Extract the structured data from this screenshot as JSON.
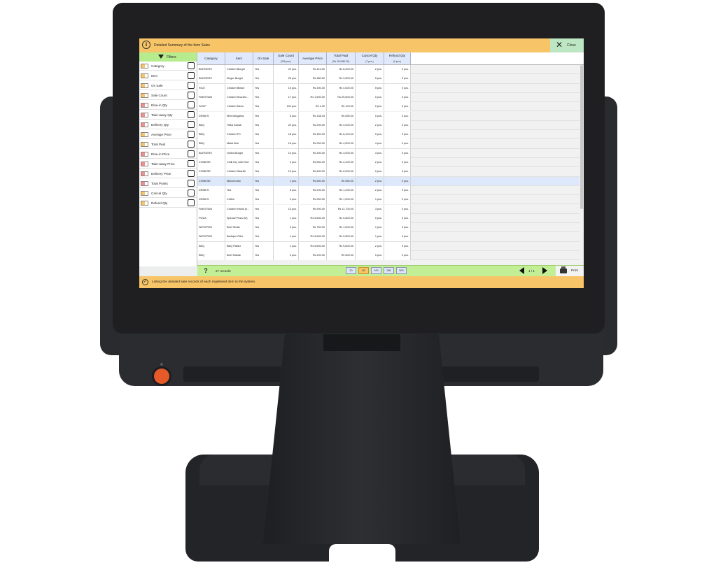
{
  "window": {
    "title": "Detailed Summary of the Item Sales",
    "close_label": "Close"
  },
  "filters": {
    "label": "Filters",
    "items": [
      {
        "label": "Category",
        "swatch": "#f7c567"
      },
      {
        "label": "Item",
        "swatch": "#f7c567"
      },
      {
        "label": "On Sale",
        "swatch": "#f7c567"
      },
      {
        "label": "Sale Count",
        "swatch": "#f7c567"
      },
      {
        "label": "Dine-in Qty",
        "swatch": "#ef8f8f"
      },
      {
        "label": "Take-away Qty",
        "swatch": "#ef8f8f"
      },
      {
        "label": "Delivery Qty",
        "swatch": "#ef8f8f"
      },
      {
        "label": "Average Price",
        "swatch": "#f7c567"
      },
      {
        "label": "Total Paid",
        "swatch": "#f7c567"
      },
      {
        "label": "Dine-in Price",
        "swatch": "#ef8f8f"
      },
      {
        "label": "Take-away Price",
        "swatch": "#ef8f8f"
      },
      {
        "label": "Delivery Price",
        "swatch": "#ef8f8f"
      },
      {
        "label": "Total Points",
        "swatch": "#ef8f8f"
      },
      {
        "label": "Cancel Qty",
        "swatch": "#f7c567"
      },
      {
        "label": "Refund Qty",
        "swatch": "#f7c567"
      }
    ]
  },
  "table": {
    "columns": [
      {
        "label": "Category",
        "sub": ""
      },
      {
        "label": "Item",
        "sub": ""
      },
      {
        "label": "On Sale",
        "sub": ""
      },
      {
        "label": "Sale Count",
        "sub": "(266 pcs.)"
      },
      {
        "label": "Average Price",
        "sub": ""
      },
      {
        "label": "Total Paid",
        "sub": "(Rs 116,980.00)"
      },
      {
        "label": "Cancel Qty",
        "sub": "(7 pcs.)"
      },
      {
        "label": "Refund Qty",
        "sub": "(0 pcs.)"
      }
    ],
    "rows": [
      [
        "BURGERS",
        "Chicken Burger",
        "Yes",
        "20 pcs.",
        "Rs 410.00",
        "Rs 8,200.00",
        "2 pcs.",
        "0 pcs."
      ],
      [
        "BURGERS",
        "Zinger Burger",
        "Yes",
        "25 pcs.",
        "Rs 380.52",
        "Rs 9,500.00",
        "5 pcs.",
        "0 pcs."
      ],
      [
        "RICE",
        "Chicken Biriani",
        "Yes",
        "15 pcs.",
        "Rs 300.00",
        "Rs 4,500.00",
        "5 pcs.",
        "0 pcs."
      ],
      [
        "PAKISTANI",
        "Chicken Kharahi...",
        "Yes",
        "17 pcs.",
        "Rs 1,500.00",
        "Rs 25,500.00",
        "0 pcs.",
        "0 pcs."
      ],
      [
        "SOUP",
        "Chicken Menu",
        "Yes",
        "100 pcs.",
        "Rs 1.00",
        "Rs 100.00",
        "0 pcs.",
        "0 pcs."
      ],
      [
        "DRINKS",
        "Mint Margarita",
        "Yes",
        "6 pcs.",
        "Rs 138.33",
        "Rs 830.00",
        "0 pcs.",
        "0 pcs."
      ],
      [
        "BBQ",
        "Tikka Kabab",
        "Yes",
        "20 pcs.",
        "Rs 200.00",
        "Rs 4,000.00",
        "2 pcs.",
        "0 pcs."
      ],
      [
        "BBQ",
        "Chicken PC",
        "Yes",
        "18 pcs.",
        "Rs 450.00",
        "Rs 8,100.00",
        "0 pcs.",
        "0 pcs."
      ],
      [
        "BBQ",
        "Malai Boti",
        "Yes",
        "18 pcs.",
        "Rs 250.00",
        "Rs 4,500.00",
        "4 pcs.",
        "0 pcs."
      ],
      [
        "BURGERS",
        "Grilled Burger",
        "Yes",
        "10 pcs.",
        "Rs 300.00",
        "Rs 3,000.00",
        "3 pcs.",
        "0 pcs."
      ],
      [
        "CHINESE",
        "Chilli Dry with Rice",
        "Yes",
        "4 pcs.",
        "Rs 550.00",
        "Rs 2,200.00",
        "2 pcs.",
        "0 pcs."
      ],
      [
        "CHINESE",
        "Chicken Sashlik",
        "Yes",
        "10 pcs.",
        "Rs 600.00",
        "Rs 6,000.00",
        "0 pcs.",
        "0 pcs."
      ],
      [
        "CHINESE",
        "Manchorian",
        "Yes",
        "1 pcs.",
        "Rs 550.00",
        "Rs 550.00",
        "2 pcs.",
        "0 pcs."
      ],
      [
        "DRINKS",
        "Tea",
        "Yes",
        "6 pcs.",
        "Rs 200.00",
        "Rs 1,200.00",
        "2 pcs.",
        "0 pcs."
      ],
      [
        "DRINKS",
        "Coffee",
        "Yes",
        "4 pcs.",
        "Rs 250.00",
        "Rs 1,000.00",
        "1 pcs.",
        "0 pcs."
      ],
      [
        "PAKISTANI",
        "Chicken Handi (h...",
        "Yes",
        "13 pcs.",
        "Rs 900.00",
        "Rs 11,700.00",
        "3 pcs.",
        "0 pcs."
      ],
      [
        "PIZZA",
        "Special Pizza (M)",
        "Yes",
        "1 pcs.",
        "Rs 5,600.00",
        "Rs 5,600.00",
        "0 pcs.",
        "0 pcs."
      ],
      [
        "WESTREN",
        "Beef Steak",
        "Yes",
        "2 pcs.",
        "Rs 750.00",
        "Rs 1,500.00",
        "1 pcs.",
        "0 pcs."
      ],
      [
        "WESTREN",
        "Barbque Ribs",
        "Yes",
        "1 pcs.",
        "Rs 5,500.00",
        "Rs 5,500.00",
        "1 pcs.",
        "0 pcs."
      ],
      [
        "BBQ",
        "BBQ Platter",
        "Yes",
        "1 pcs.",
        "Rs 5,600.00",
        "Rs 5,600.00",
        "2 pcs.",
        "0 pcs."
      ],
      [
        "BBQ",
        "Beef Kabab",
        "Yes",
        "3 pcs.",
        "Rs 200.00",
        "Rs 600.00",
        "0 pcs.",
        "0 pcs."
      ]
    ],
    "selected_row": 12
  },
  "footer": {
    "help": "?",
    "records": "27 records",
    "page_sizes": [
      "20",
      "50",
      "100",
      "250",
      "500"
    ],
    "page_size_selected": 1,
    "page": "1 / 1",
    "print_label": "Print"
  },
  "status": {
    "text": "Listing the detailed sale records of each registered item in the system."
  }
}
